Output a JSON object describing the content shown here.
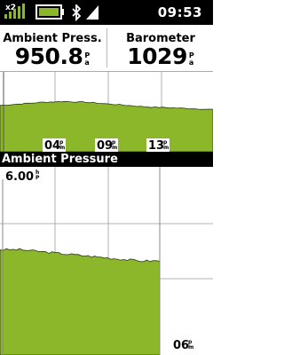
{
  "status_bar": {
    "satellite_count": "x2",
    "time": "09:53",
    "icons": [
      "satellite-signal-icon",
      "battery-icon",
      "bluetooth-icon",
      "cellular-signal-icon"
    ]
  },
  "fields": [
    {
      "label": "Ambient Press.",
      "value": "950.8",
      "unit_top": "P",
      "unit_bottom": "a"
    },
    {
      "label": "Barometer",
      "value": "1029",
      "unit_top": "P",
      "unit_bottom": "a"
    }
  ],
  "section_title": "Ambient Pressure",
  "scale_label": {
    "value": "6.00",
    "unit_top": "h",
    "unit_bottom": "P"
  },
  "colors": {
    "accent": "#8cb72a",
    "status_bg": "#000000"
  },
  "chart_data": [
    {
      "type": "area",
      "title": "",
      "x_tick_labels": [
        "04",
        "09",
        "13"
      ],
      "x_tick_suffix": {
        "top": "p",
        "bottom": "m"
      },
      "x": [
        0,
        10,
        20,
        30,
        40,
        50,
        60,
        70,
        80,
        90,
        100
      ],
      "series": [
        {
          "values": [
            0.58,
            0.6,
            0.62,
            0.63,
            0.62,
            0.6,
            0.58,
            0.56,
            0.55,
            0.54,
            0.53
          ]
        }
      ],
      "ylim": [
        0,
        1
      ],
      "grid": true
    },
    {
      "type": "area",
      "title": "",
      "x_tick_labels": [
        "06"
      ],
      "x_tick_suffix": {
        "top": "p",
        "bottom": "m"
      },
      "x": [
        0,
        10,
        20,
        30,
        40,
        50,
        60,
        70,
        75
      ],
      "series": [
        {
          "values": [
            0.56,
            0.56,
            0.55,
            0.54,
            0.53,
            0.52,
            0.51,
            0.5,
            0.5
          ]
        }
      ],
      "ylim": [
        0,
        1
      ],
      "grid": true
    }
  ]
}
